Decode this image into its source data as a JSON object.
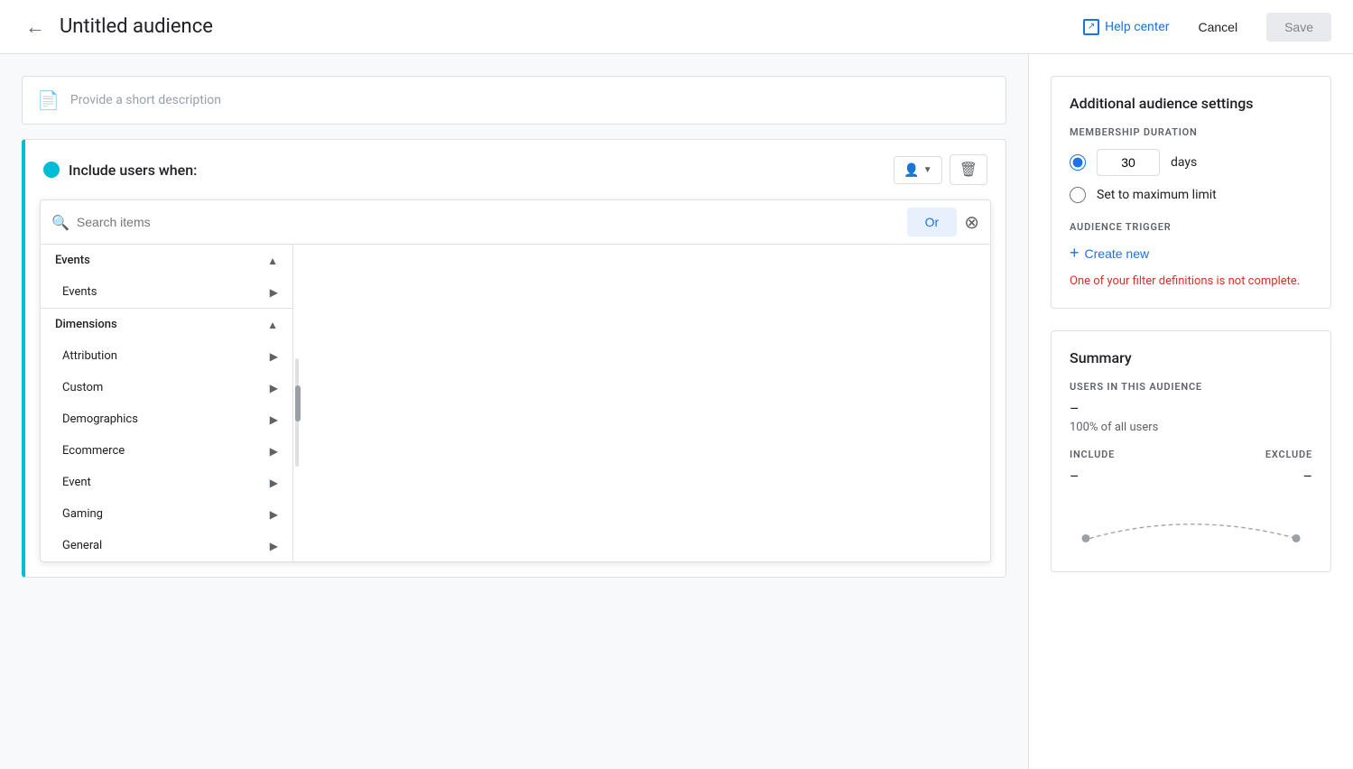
{
  "header": {
    "back_label": "←",
    "title": "Untitled audience",
    "help_label": "Help center",
    "cancel_label": "Cancel",
    "save_label": "Save"
  },
  "description": {
    "placeholder": "Provide a short description"
  },
  "include_section": {
    "title": "Include users when:",
    "person_icon": "👤",
    "trash_icon": "🗑"
  },
  "search": {
    "placeholder": "Search items"
  },
  "buttons": {
    "or_label": "Or"
  },
  "dropdown": {
    "sections": [
      {
        "label": "Events",
        "expanded": true,
        "items": [
          {
            "label": "Events",
            "has_children": true
          }
        ]
      },
      {
        "label": "Dimensions",
        "expanded": true,
        "items": [
          {
            "label": "Attribution",
            "has_children": true
          },
          {
            "label": "Custom",
            "has_children": true
          },
          {
            "label": "Demographics",
            "has_children": true
          },
          {
            "label": "Ecommerce",
            "has_children": true
          },
          {
            "label": "Event",
            "has_children": true
          },
          {
            "label": "Gaming",
            "has_children": true
          },
          {
            "label": "General",
            "has_children": true
          }
        ]
      }
    ]
  },
  "right_panel": {
    "settings": {
      "title": "Additional audience settings",
      "membership_duration_label": "MEMBERSHIP DURATION",
      "days_value": "30",
      "days_label": "days",
      "radio_days_selected": true,
      "max_limit_label": "Set to maximum limit",
      "audience_trigger_label": "AUDIENCE TRIGGER",
      "create_new_label": "Create new",
      "error_message": "One of your filter definitions is not complete."
    },
    "summary": {
      "title": "Summary",
      "users_label": "USERS IN THIS AUDIENCE",
      "users_value": "–",
      "users_pct": "100% of all users",
      "include_label": "INCLUDE",
      "exclude_label": "EXCLUDE",
      "include_value": "–",
      "exclude_value": "–"
    }
  }
}
